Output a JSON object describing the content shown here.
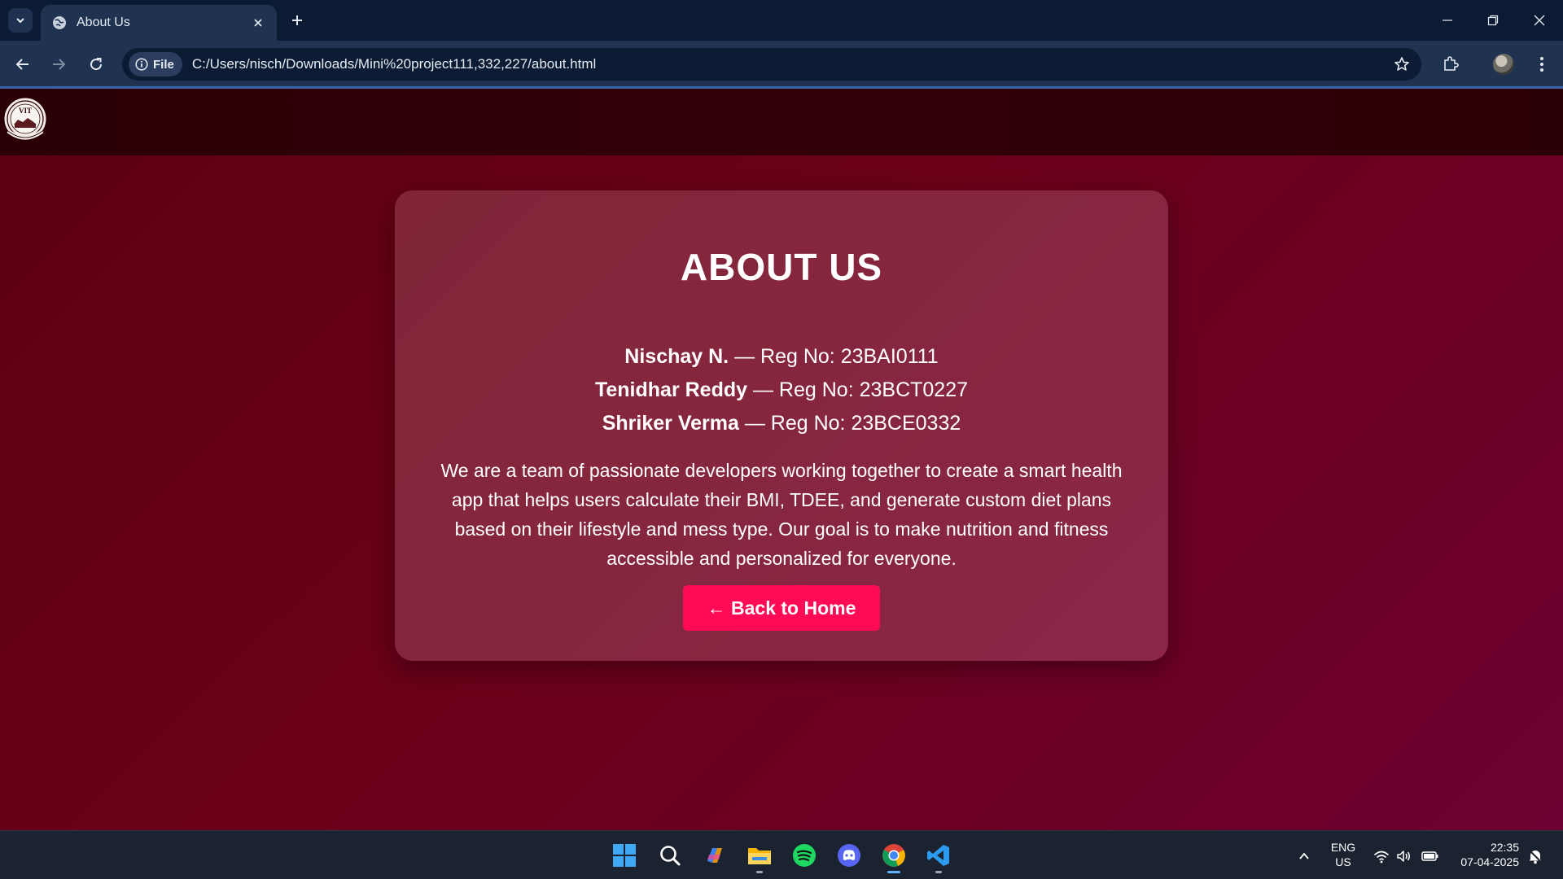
{
  "browser": {
    "tab_title": "About Us",
    "file_chip": "File",
    "url": "C:/Users/nisch/Downloads/Mini%20project111,332,227/about.html",
    "icons": [
      "tab-search-icon",
      "globe-icon",
      "close-icon",
      "plus-icon",
      "minimize-icon",
      "restore-icon",
      "window-close-icon",
      "back-icon",
      "forward-icon",
      "reload-icon",
      "info-icon",
      "star-icon",
      "extensions-icon",
      "avatar",
      "kebab-menu-icon"
    ]
  },
  "page": {
    "logo_text": "VIT",
    "title": "ABOUT US",
    "members": [
      {
        "name": "Nischay N.",
        "reg": " — Reg No: 23BAI0111"
      },
      {
        "name": "Tenidhar Reddy",
        "reg": " — Reg No: 23BCT0227"
      },
      {
        "name": "Shriker Verma",
        "reg": " — Reg No: 23BCE0332"
      }
    ],
    "description": "We are a team of passionate developers working together to create a smart health app that helps users calculate their BMI, TDEE, and generate custom diet plans based on their lifestyle and mess type. Our goal is to make nutrition and fitness accessible and personalized for everyone.",
    "back_button": "← Back to Home"
  },
  "colors": {
    "background": "#6a0018",
    "header": "#300007",
    "button": "#ff0a55",
    "browser_frame": "#0c1b34",
    "toolbar": "#1f3250"
  },
  "taskbar": {
    "apps": [
      "windows-start-icon",
      "search-icon",
      "copilot-icon",
      "file-explorer-icon",
      "spotify-icon",
      "discord-icon",
      "chrome-icon",
      "vscode-icon"
    ],
    "lang_line1": "ENG",
    "lang_line2": "US",
    "time": "22:35",
    "date": "07-04-2025"
  }
}
